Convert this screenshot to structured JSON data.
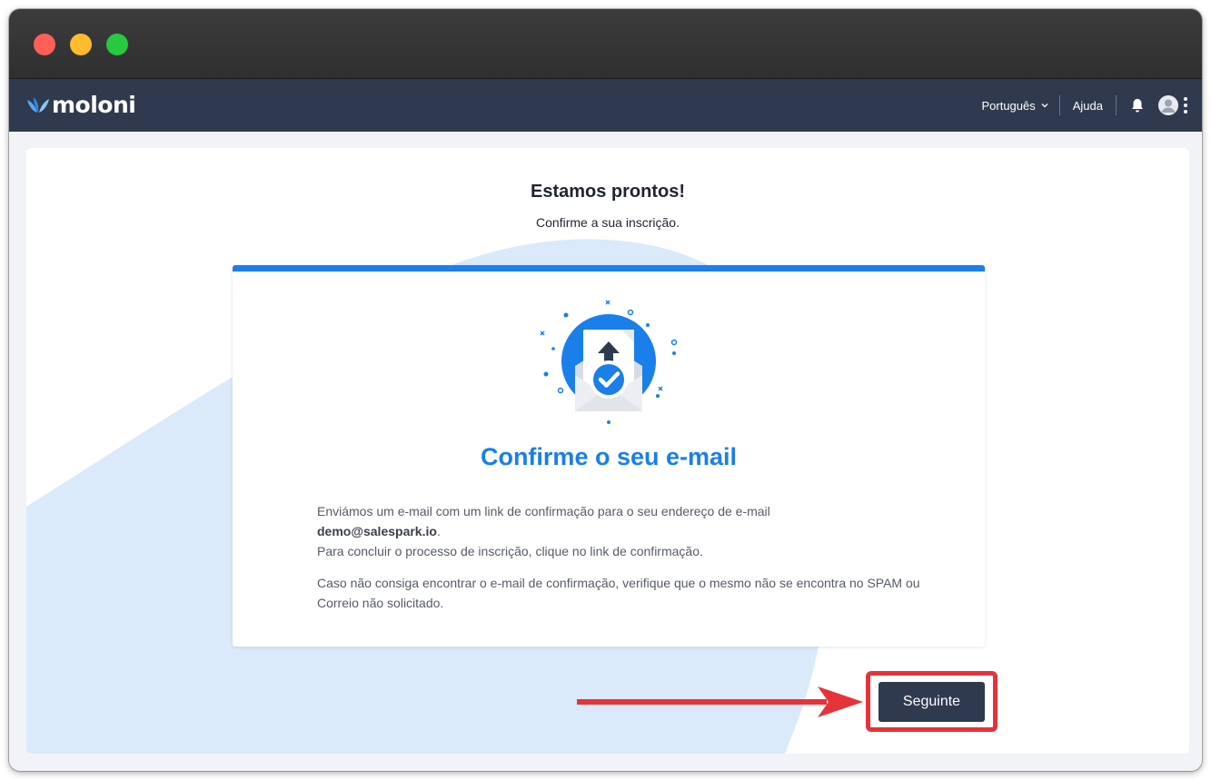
{
  "window": {
    "controls": [
      "close",
      "minimize",
      "zoom"
    ]
  },
  "navbar": {
    "logo_text": "moloni",
    "language": "Português",
    "help": "Ajuda",
    "icons": [
      "bell-icon",
      "avatar-icon",
      "more-vertical-icon"
    ]
  },
  "page": {
    "title": "Estamos prontos!",
    "subtitle": "Confirme a sua inscrição."
  },
  "card": {
    "title": "Confirme o seu e-mail",
    "p1_before": "Enviámos um e-mail com um link de confirmação para o seu endereço de e-mail ",
    "email": "demo@salespark.io",
    "p1_after": ".",
    "p1_line2": "Para concluir o processo de inscrição, clique no link de confirmação.",
    "p2": "Caso não consiga encontrar o e-mail de confirmação, verifique que o mesmo não se encontra no SPAM ou Correio não solicitado."
  },
  "actions": {
    "next_label": "Seguinte"
  },
  "colors": {
    "accent": "#1a7fe8",
    "navbar": "#2f3a4e",
    "highlight": "#e6333a",
    "background_shape": "#dbeafb"
  }
}
